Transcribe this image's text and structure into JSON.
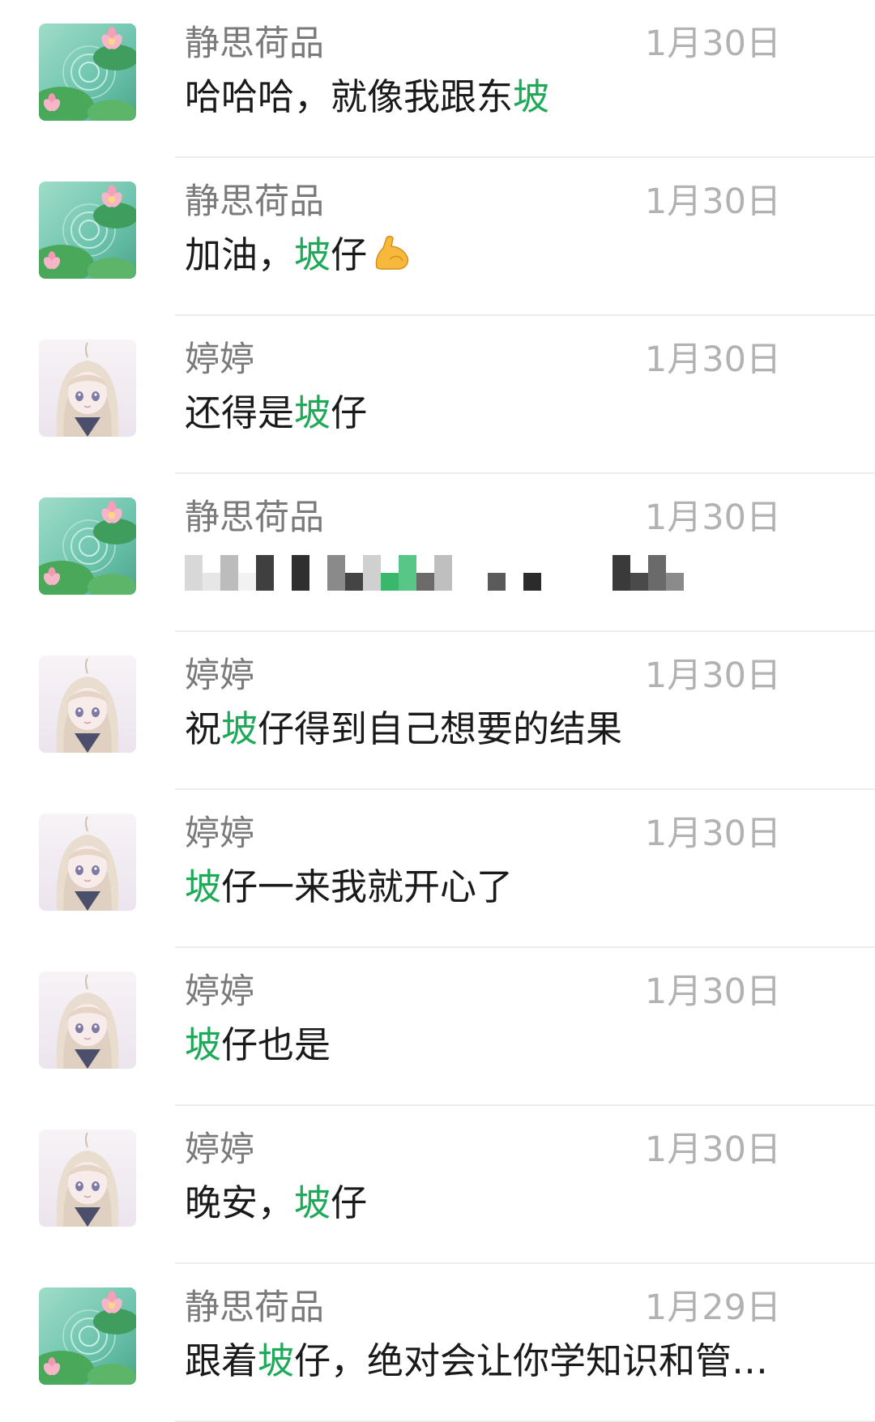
{
  "colors": {
    "highlight": "#1faa59",
    "name_text": "#7a7a7a",
    "time_text": "#b2b2b2",
    "message_text": "#1a1a1a"
  },
  "chats": [
    {
      "name": "静思荷品",
      "time": "1月30日",
      "avatar": "lotus-avatar",
      "msg_before": "哈哈哈，就像我跟东",
      "msg_highlight": "坡",
      "msg_after": ""
    },
    {
      "name": "静思荷品",
      "time": "1月30日",
      "avatar": "lotus-avatar",
      "msg_before": "加油，",
      "msg_highlight": "坡",
      "msg_after": "仔",
      "emoji": "flexed-biceps-emoji"
    },
    {
      "name": "婷婷",
      "time": "1月30日",
      "avatar": "girl-avatar",
      "msg_before": "还得是",
      "msg_highlight": "坡",
      "msg_after": "仔"
    },
    {
      "name": "静思荷品",
      "time": "1月30日",
      "avatar": "lotus-avatar",
      "msg_redacted": true
    },
    {
      "name": "婷婷",
      "time": "1月30日",
      "avatar": "girl-avatar",
      "msg_before": "祝",
      "msg_highlight": "坡",
      "msg_after": "仔得到自己想要的结果"
    },
    {
      "name": "婷婷",
      "time": "1月30日",
      "avatar": "girl-avatar",
      "msg_before": "",
      "msg_highlight": "坡",
      "msg_after": "仔一来我就开心了"
    },
    {
      "name": "婷婷",
      "time": "1月30日",
      "avatar": "girl-avatar",
      "msg_before": "",
      "msg_highlight": "坡",
      "msg_after": "仔也是"
    },
    {
      "name": "婷婷",
      "time": "1月30日",
      "avatar": "girl-avatar",
      "msg_before": "晚安，",
      "msg_highlight": "坡",
      "msg_after": "仔"
    },
    {
      "name": "静思荷品",
      "time": "1月29日",
      "avatar": "lotus-avatar",
      "msg_before": "跟着",
      "msg_highlight": "坡",
      "msg_after": "仔，绝对会让你学知识和管…"
    }
  ]
}
